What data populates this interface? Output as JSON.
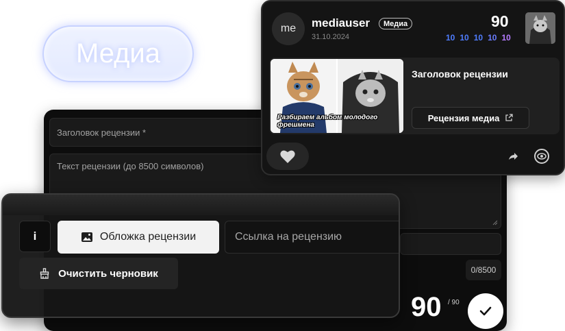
{
  "pill": {
    "label": "Медиа"
  },
  "form": {
    "title_placeholder": "Заголовок рецензии *",
    "body_placeholder": "Текст рецензии (до 8500 символов)",
    "char_counter": "0/8500",
    "score": "90",
    "score_max": "/ 90"
  },
  "panel": {
    "info_label": "i",
    "cover_button_label": "Обложка рецензии",
    "link_placeholder": "Ссылка на рецензию",
    "clear_button_label": "Очистить черновик"
  },
  "card": {
    "avatar_initials": "me",
    "username": "mediauser",
    "role_badge": "Медиа",
    "date": "31.10.2024",
    "score": "90",
    "subscores": [
      {
        "value": "10",
        "color": "#4f7dff"
      },
      {
        "value": "10",
        "color": "#4f7dff"
      },
      {
        "value": "10",
        "color": "#4f7dff"
      },
      {
        "value": "10",
        "color": "#6a7cff"
      },
      {
        "value": "10",
        "color": "#b57bff"
      }
    ],
    "cover_caption": "Разбираем альбом молодого фрешмена",
    "review_title": "Заголовок рецензии",
    "open_button_label": "Рецензия медиа",
    "icons": [
      "heart-icon",
      "share-icon",
      "eye-icon",
      "external-link-icon"
    ]
  }
}
